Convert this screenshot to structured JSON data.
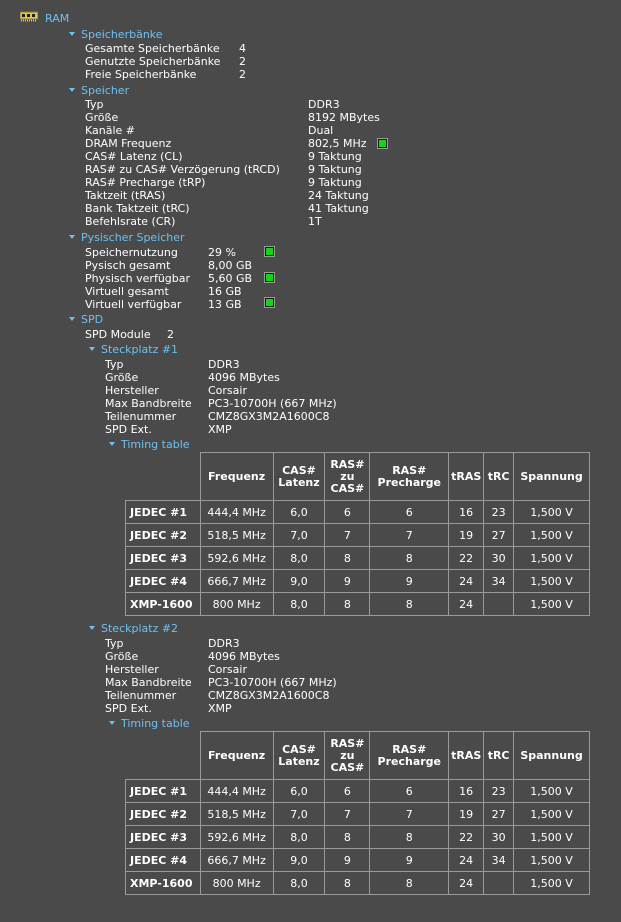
{
  "root": {
    "title": "RAM"
  },
  "banks": {
    "title": "Speicherbänke",
    "rows": [
      {
        "label": "Gesamte Speicherbänke",
        "value": "4"
      },
      {
        "label": "Genutzte Speicherbänke",
        "value": "2"
      },
      {
        "label": "Freie Speicherbänke",
        "value": "2"
      }
    ]
  },
  "memory": {
    "title": "Speicher",
    "rows": [
      {
        "label": "Typ",
        "value": "DDR3"
      },
      {
        "label": "Größe",
        "value": "8192 MBytes"
      },
      {
        "label": "Kanäle #",
        "value": "Dual"
      },
      {
        "label": "DRAM Frequenz",
        "value": "802,5 MHz"
      },
      {
        "label": "CAS# Latenz (CL)",
        "value": "9 Taktung"
      },
      {
        "label": "RAS# zu CAS# Verzögerung (tRCD)",
        "value": "9 Taktung"
      },
      {
        "label": "RAS# Precharge (tRP)",
        "value": "9 Taktung"
      },
      {
        "label": "Taktzeit (tRAS)",
        "value": "24 Taktung"
      },
      {
        "label": "Bank Taktzeit (tRC)",
        "value": "41 Taktung"
      },
      {
        "label": "Befehlsrate (CR)",
        "value": "1T"
      }
    ]
  },
  "physical": {
    "title": "Pysischer Speicher",
    "rows": [
      {
        "label": "Speichernutzung",
        "value": "29 %"
      },
      {
        "label": "Pysisch gesamt",
        "value": "8,00 GB"
      },
      {
        "label": "Physisch verfügbar",
        "value": "5,60 GB"
      },
      {
        "label": "Virtuell gesamt",
        "value": "16 GB"
      },
      {
        "label": "Virtuell verfügbar",
        "value": "13 GB"
      }
    ]
  },
  "spd": {
    "title": "SPD",
    "modules_label": "SPD Module",
    "modules_value": "2",
    "timing_headers": [
      "Frequenz",
      "CAS# Latenz",
      "RAS# zu CAS#",
      "RAS# Precharge",
      "tRAS",
      "tRC",
      "Spannung"
    ],
    "slots": [
      {
        "title": "Steckplatz #1",
        "rows": [
          {
            "label": "Typ",
            "value": "DDR3"
          },
          {
            "label": "Größe",
            "value": "4096 MBytes"
          },
          {
            "label": "Hersteller",
            "value": "Corsair"
          },
          {
            "label": "Max Bandbreite",
            "value": "PC3-10700H (667 MHz)"
          },
          {
            "label": "Teilenummer",
            "value": "CMZ8GX3M2A1600C8"
          },
          {
            "label": "SPD Ext.",
            "value": "XMP"
          }
        ],
        "timing_title": "Timing table",
        "timing": [
          [
            "JEDEC #1",
            "444,4 MHz",
            "6,0",
            "6",
            "6",
            "16",
            "23",
            "1,500 V"
          ],
          [
            "JEDEC #2",
            "518,5 MHz",
            "7,0",
            "7",
            "7",
            "19",
            "27",
            "1,500 V"
          ],
          [
            "JEDEC #3",
            "592,6 MHz",
            "8,0",
            "8",
            "8",
            "22",
            "30",
            "1,500 V"
          ],
          [
            "JEDEC #4",
            "666,7 MHz",
            "9,0",
            "9",
            "9",
            "24",
            "34",
            "1,500 V"
          ],
          [
            "XMP-1600",
            "800 MHz",
            "8,0",
            "8",
            "8",
            "24",
            "",
            "1,500 V"
          ]
        ]
      },
      {
        "title": "Steckplatz #2",
        "rows": [
          {
            "label": "Typ",
            "value": "DDR3"
          },
          {
            "label": "Größe",
            "value": "4096 MBytes"
          },
          {
            "label": "Hersteller",
            "value": "Corsair"
          },
          {
            "label": "Max Bandbreite",
            "value": "PC3-10700H (667 MHz)"
          },
          {
            "label": "Teilenummer",
            "value": "CMZ8GX3M2A1600C8"
          },
          {
            "label": "SPD Ext.",
            "value": "XMP"
          }
        ],
        "timing_title": "Timing table",
        "timing": [
          [
            "JEDEC #1",
            "444,4 MHz",
            "6,0",
            "6",
            "6",
            "16",
            "23",
            "1,500 V"
          ],
          [
            "JEDEC #2",
            "518,5 MHz",
            "7,0",
            "7",
            "7",
            "19",
            "27",
            "1,500 V"
          ],
          [
            "JEDEC #3",
            "592,6 MHz",
            "8,0",
            "8",
            "8",
            "22",
            "30",
            "1,500 V"
          ],
          [
            "JEDEC #4",
            "666,7 MHz",
            "9,0",
            "9",
            "9",
            "24",
            "34",
            "1,500 V"
          ],
          [
            "XMP-1600",
            "800 MHz",
            "8,0",
            "8",
            "8",
            "24",
            "",
            "1,500 V"
          ]
        ]
      }
    ]
  },
  "colors": {
    "background": "#4a4a4a",
    "header_text": "#6ec0f2",
    "gauge_fill": "#18d418",
    "grid_line": "#9a9a9a"
  }
}
